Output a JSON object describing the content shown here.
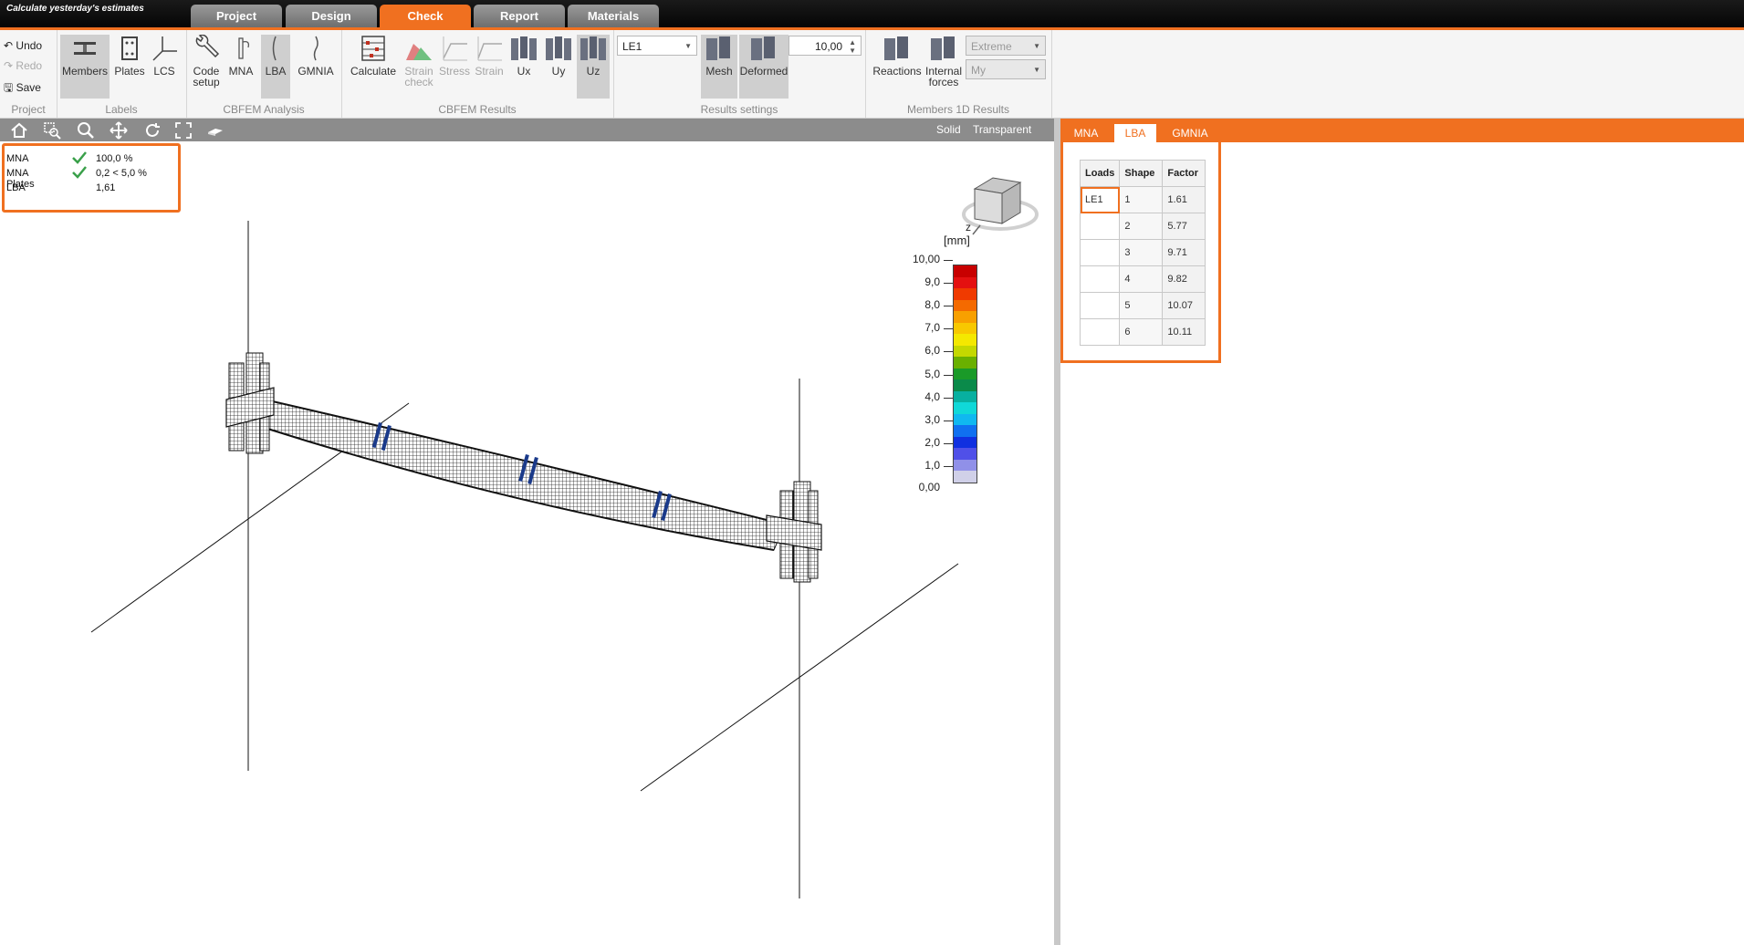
{
  "app": {
    "title": "Calculate yesterday's estimates"
  },
  "tabs": [
    {
      "label": "Project",
      "active": false
    },
    {
      "label": "Design",
      "active": false
    },
    {
      "label": "Check",
      "active": true
    },
    {
      "label": "Report",
      "active": false
    },
    {
      "label": "Materials",
      "active": false
    }
  ],
  "ribbon": {
    "project": {
      "undo": "Undo",
      "redo": "Redo",
      "save": "Save",
      "group_label": "Project"
    },
    "labels": {
      "members": "Members",
      "plates": "Plates",
      "lcs": "LCS",
      "group_label": "Labels"
    },
    "cbfem_analysis": {
      "code_setup_line1": "Code",
      "code_setup_line2": "setup",
      "mna": "MNA",
      "lba": "LBA",
      "gmnia": "GMNIA",
      "group_label": "CBFEM Analysis"
    },
    "cbfem_results": {
      "calculate": "Calculate",
      "strain_check_line1": "Strain",
      "strain_check_line2": "check",
      "stress": "Stress",
      "strain": "Strain",
      "ux": "Ux",
      "uy": "Uy",
      "uz": "Uz",
      "group_label": "CBFEM Results"
    },
    "results_settings": {
      "load_case": "LE1",
      "scale_value": "10,00",
      "mesh": "Mesh",
      "deformed": "Deformed",
      "group_label": "Results settings"
    },
    "members_1d": {
      "reactions": "Reactions",
      "internal_forces_line1": "Internal",
      "internal_forces_line2": "forces",
      "extreme": "Extreme",
      "my": "My",
      "group_label": "Members 1D Results"
    }
  },
  "viewtool": {
    "solid": "Solid",
    "transparent": "Transparent"
  },
  "summary": [
    {
      "label": "MNA",
      "value": "100,0 %",
      "check": true
    },
    {
      "label": "MNA Plates",
      "value": "0,2 < 5,0 %",
      "check": true
    },
    {
      "label": "LBA",
      "value": "1,61",
      "check": false
    }
  ],
  "legend": {
    "title": "z",
    "unit": "[mm]",
    "ticks": [
      "10,00",
      "9,0",
      "8,0",
      "7,0",
      "6,0",
      "5,0",
      "4,0",
      "3,0",
      "2,0",
      "1,0",
      "0,00"
    ],
    "colors": [
      "#c80000",
      "#e41010",
      "#f03a00",
      "#f46a00",
      "#f8a000",
      "#f8c800",
      "#f4e800",
      "#c4d800",
      "#6ab000",
      "#1a9a28",
      "#0a8a4a",
      "#08b0a0",
      "#10d8d8",
      "#10b8f0",
      "#1070f0",
      "#1030e0",
      "#5050e8",
      "#9090e8",
      "#d0d0e8"
    ]
  },
  "right_panel": {
    "tabs": [
      {
        "label": "MNA",
        "active": false
      },
      {
        "label": "LBA",
        "active": true
      },
      {
        "label": "GMNIA",
        "active": false
      }
    ],
    "columns": [
      "Loads",
      "Shape",
      "Factor"
    ],
    "rows": [
      {
        "load": "LE1",
        "shape": "1",
        "factor": "1.61"
      },
      {
        "load": "",
        "shape": "2",
        "factor": "5.77"
      },
      {
        "load": "",
        "shape": "3",
        "factor": "9.71"
      },
      {
        "load": "",
        "shape": "4",
        "factor": "9.82"
      },
      {
        "load": "",
        "shape": "5",
        "factor": "10.07"
      },
      {
        "load": "",
        "shape": "6",
        "factor": "10.11"
      }
    ]
  }
}
